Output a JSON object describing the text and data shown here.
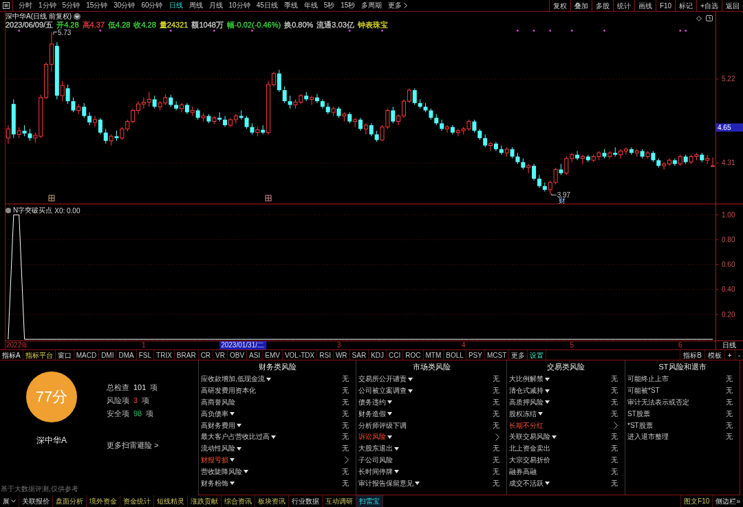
{
  "toolbar": {
    "periods": [
      {
        "label": "分时",
        "kind": "period",
        "selected": false
      },
      {
        "label": "1分钟",
        "kind": "period",
        "selected": false
      },
      {
        "label": "5分钟",
        "kind": "period",
        "selected": false
      },
      {
        "label": "15分钟",
        "kind": "period",
        "selected": false
      },
      {
        "label": "30分钟",
        "kind": "period",
        "selected": false
      },
      {
        "label": "60分钟",
        "kind": "period",
        "selected": false
      },
      {
        "label": "日线",
        "kind": "period",
        "selected": true
      },
      {
        "label": "周线",
        "kind": "period",
        "selected": false
      },
      {
        "label": "月线",
        "kind": "period",
        "selected": false
      },
      {
        "label": "10分钟",
        "kind": "period",
        "selected": false
      },
      {
        "label": "45日线",
        "kind": "period",
        "selected": false
      },
      {
        "label": "季线",
        "kind": "period",
        "selected": false
      },
      {
        "label": "年线",
        "kind": "period",
        "selected": false
      },
      {
        "label": "5秒",
        "kind": "period",
        "selected": false
      },
      {
        "label": "15秒",
        "kind": "period",
        "selected": false
      },
      {
        "label": "多周期",
        "kind": "period",
        "selected": false
      },
      {
        "label": "更多",
        "kind": "menu",
        "selected": false
      }
    ],
    "buttons": [
      "复权",
      "叠加",
      "多股",
      "统计",
      "画线",
      "F10",
      "标记",
      "+自选",
      "返回"
    ]
  },
  "price_pane": {
    "title": "深中华A(日线 前复权)",
    "quote": [
      {
        "text": "2023/06/09/五",
        "color": "#c8c8c8"
      },
      {
        "text": "开4.28",
        "color": "#3cd23c"
      },
      {
        "text": "高4.37",
        "color": "#e63c3c"
      },
      {
        "text": "低4.28",
        "color": "#3cd23c"
      },
      {
        "text": "收4.28",
        "color": "#3cd23c"
      },
      {
        "text": "量24321",
        "color": "#d8d830"
      },
      {
        "text": "额1048万",
        "color": "#c8c8c8"
      },
      {
        "text": "幅-0.02(-0.46%)",
        "color": "#3cd23c"
      },
      {
        "text": "换0.80%",
        "color": "#c8c8c8"
      },
      {
        "text": "流通3.03亿",
        "color": "#c8c8c8"
      },
      {
        "text": "钟表珠宝",
        "color": "#d8d830"
      }
    ],
    "cursor_price": "4.65",
    "chart_data": [
      {
        "type": "candlestick",
        "ylim": [
          3.87,
          5.95
        ],
        "yticks": [
          4.31,
          5.22
        ],
        "grid": true,
        "annotations": [
          "5.73",
          "3.97",
          "财"
        ],
        "ohlc": [
          [
            4.58,
            4.72,
            4.52,
            4.68
          ],
          [
            4.95,
            5.0,
            4.58,
            4.62
          ],
          [
            4.62,
            4.7,
            4.58,
            4.66
          ],
          [
            4.66,
            4.72,
            4.6,
            4.63
          ],
          [
            4.63,
            4.68,
            4.55,
            4.58
          ],
          [
            4.58,
            4.64,
            4.53,
            4.61
          ],
          [
            4.6,
            5.05,
            4.58,
            5.02
          ],
          [
            5.02,
            5.4,
            5.0,
            5.38
          ],
          [
            5.38,
            5.73,
            5.3,
            5.6
          ],
          [
            5.58,
            5.62,
            5.0,
            5.04
          ],
          [
            5.04,
            5.2,
            4.98,
            5.15
          ],
          [
            5.12,
            5.16,
            4.95,
            4.98
          ],
          [
            4.98,
            5.02,
            4.86,
            4.88
          ],
          [
            4.88,
            4.95,
            4.84,
            4.92
          ],
          [
            4.92,
            4.96,
            4.8,
            4.82
          ],
          [
            4.82,
            4.86,
            4.72,
            4.75
          ],
          [
            4.75,
            4.82,
            4.7,
            4.78
          ],
          [
            4.78,
            4.8,
            4.62,
            4.64
          ],
          [
            4.64,
            4.68,
            4.52,
            4.55
          ],
          [
            4.55,
            4.62,
            4.5,
            4.6
          ],
          [
            4.6,
            4.66,
            4.55,
            4.58
          ],
          [
            4.58,
            4.7,
            4.56,
            4.68
          ],
          [
            4.68,
            4.78,
            4.65,
            4.76
          ],
          [
            4.76,
            4.9,
            4.74,
            4.88
          ],
          [
            4.88,
            4.98,
            4.84,
            4.95
          ],
          [
            4.95,
            5.02,
            4.9,
            4.97
          ],
          [
            4.97,
            5.08,
            4.92,
            5.0
          ],
          [
            5.0,
            5.04,
            4.9,
            4.92
          ],
          [
            4.92,
            4.98,
            4.88,
            4.96
          ],
          [
            4.96,
            5.06,
            4.94,
            5.02
          ],
          [
            5.02,
            5.05,
            4.92,
            4.94
          ],
          [
            4.94,
            4.98,
            4.88,
            4.9
          ],
          [
            4.9,
            4.96,
            4.86,
            4.94
          ],
          [
            4.94,
            4.96,
            4.84,
            4.86
          ],
          [
            4.86,
            4.92,
            4.82,
            4.88
          ],
          [
            4.88,
            4.9,
            4.78,
            4.8
          ],
          [
            4.8,
            4.85,
            4.76,
            4.82
          ],
          [
            4.82,
            4.84,
            4.74,
            4.76
          ],
          [
            4.76,
            4.82,
            4.73,
            4.8
          ],
          [
            4.8,
            4.86,
            4.76,
            4.78
          ],
          [
            4.78,
            4.82,
            4.7,
            4.72
          ],
          [
            4.72,
            4.8,
            4.7,
            4.78
          ],
          [
            4.78,
            4.84,
            4.74,
            4.82
          ],
          [
            4.82,
            4.88,
            4.78,
            4.8
          ],
          [
            4.8,
            4.82,
            4.68,
            4.7
          ],
          [
            4.7,
            4.74,
            4.62,
            4.64
          ],
          [
            4.64,
            4.7,
            4.6,
            4.67
          ],
          [
            4.67,
            4.72,
            4.62,
            4.64
          ],
          [
            4.64,
            5.2,
            4.62,
            5.16
          ],
          [
            5.16,
            5.3,
            5.14,
            5.28
          ],
          [
            5.28,
            5.32,
            5.08,
            5.1
          ],
          [
            5.1,
            5.14,
            4.96,
            4.98
          ],
          [
            4.98,
            5.04,
            4.9,
            4.94
          ],
          [
            4.94,
            5.0,
            4.9,
            4.97
          ],
          [
            4.97,
            5.06,
            4.95,
            5.04
          ],
          [
            5.04,
            5.08,
            4.98,
            5.0
          ],
          [
            5.0,
            5.04,
            4.94,
            5.02
          ],
          [
            5.02,
            5.06,
            4.96,
            4.98
          ],
          [
            4.98,
            5.0,
            4.9,
            4.92
          ],
          [
            4.92,
            4.96,
            4.84,
            4.86
          ],
          [
            4.86,
            4.92,
            4.82,
            4.9
          ],
          [
            4.9,
            4.92,
            4.8,
            4.82
          ],
          [
            4.82,
            4.86,
            4.76,
            4.84
          ],
          [
            4.84,
            4.86,
            4.74,
            4.76
          ],
          [
            4.76,
            4.8,
            4.7,
            4.78
          ],
          [
            4.78,
            4.8,
            4.66,
            4.68
          ],
          [
            4.68,
            4.74,
            4.62,
            4.72
          ],
          [
            4.72,
            4.74,
            4.6,
            4.62
          ],
          [
            4.62,
            4.66,
            4.54,
            4.56
          ],
          [
            4.56,
            4.72,
            4.55,
            4.7
          ],
          [
            4.7,
            4.9,
            4.68,
            4.88
          ],
          [
            4.88,
            4.92,
            4.74,
            4.76
          ],
          [
            4.76,
            4.84,
            4.72,
            4.82
          ],
          [
            4.82,
            5.0,
            4.8,
            4.98
          ],
          [
            4.98,
            5.12,
            4.96,
            5.1
          ],
          [
            5.1,
            5.12,
            4.94,
            4.96
          ],
          [
            4.96,
            5.0,
            4.9,
            4.92
          ],
          [
            4.92,
            4.96,
            4.86,
            4.88
          ],
          [
            4.88,
            4.9,
            4.78,
            4.8
          ],
          [
            4.8,
            4.84,
            4.72,
            4.74
          ],
          [
            4.74,
            4.78,
            4.66,
            4.68
          ],
          [
            4.68,
            4.72,
            4.64,
            4.7
          ],
          [
            4.7,
            4.72,
            4.62,
            4.64
          ],
          [
            4.64,
            4.68,
            4.6,
            4.66
          ],
          [
            4.66,
            4.7,
            4.62,
            4.68
          ],
          [
            4.68,
            4.78,
            4.66,
            4.76
          ],
          [
            4.76,
            4.78,
            4.64,
            4.66
          ],
          [
            4.66,
            4.68,
            4.56,
            4.58
          ],
          [
            4.58,
            4.62,
            4.48,
            4.5
          ],
          [
            4.5,
            4.54,
            4.44,
            4.52
          ],
          [
            4.52,
            4.54,
            4.44,
            4.46
          ],
          [
            4.46,
            4.5,
            4.4,
            4.42
          ],
          [
            4.42,
            4.48,
            4.38,
            4.46
          ],
          [
            4.46,
            4.48,
            4.36,
            4.38
          ],
          [
            4.38,
            4.42,
            4.3,
            4.32
          ],
          [
            4.32,
            4.36,
            4.24,
            4.26
          ],
          [
            4.26,
            4.3,
            4.2,
            4.28
          ],
          [
            4.28,
            4.3,
            4.12,
            4.14
          ],
          [
            4.14,
            4.18,
            4.04,
            4.06
          ],
          [
            4.06,
            4.1,
            4.0,
            4.02
          ],
          [
            4.02,
            4.12,
            3.97,
            4.1
          ],
          [
            4.1,
            4.26,
            4.08,
            4.24
          ],
          [
            4.24,
            4.3,
            4.18,
            4.2
          ],
          [
            4.2,
            4.38,
            4.18,
            4.36
          ],
          [
            4.36,
            4.42,
            4.32,
            4.4
          ],
          [
            4.4,
            4.44,
            4.34,
            4.36
          ],
          [
            4.36,
            4.4,
            4.3,
            4.38
          ],
          [
            4.38,
            4.4,
            4.32,
            4.34
          ],
          [
            4.34,
            4.4,
            4.32,
            4.38
          ],
          [
            4.38,
            4.44,
            4.34,
            4.42
          ],
          [
            4.42,
            4.46,
            4.36,
            4.38
          ],
          [
            4.38,
            4.44,
            4.36,
            4.42
          ],
          [
            4.42,
            4.48,
            4.38,
            4.4
          ],
          [
            4.4,
            4.46,
            4.36,
            4.44
          ],
          [
            4.44,
            4.48,
            4.4,
            4.46
          ],
          [
            4.46,
            4.48,
            4.4,
            4.42
          ],
          [
            4.42,
            4.46,
            4.38,
            4.44
          ],
          [
            4.44,
            4.46,
            4.36,
            4.38
          ],
          [
            4.38,
            4.44,
            4.36,
            4.42
          ],
          [
            4.42,
            4.44,
            4.32,
            4.34
          ],
          [
            4.34,
            4.36,
            4.26,
            4.28
          ],
          [
            4.28,
            4.32,
            4.24,
            4.3
          ],
          [
            4.3,
            4.36,
            4.28,
            4.34
          ],
          [
            4.34,
            4.36,
            4.28,
            4.3
          ],
          [
            4.3,
            4.4,
            4.28,
            4.38
          ],
          [
            4.38,
            4.4,
            4.3,
            4.32
          ],
          [
            4.32,
            4.4,
            4.3,
            4.38
          ],
          [
            4.38,
            4.42,
            4.34,
            4.4
          ],
          [
            4.4,
            4.42,
            4.32,
            4.34
          ],
          [
            4.34,
            4.4,
            4.3,
            4.36
          ],
          [
            4.28,
            4.37,
            4.28,
            4.28
          ]
        ]
      }
    ]
  },
  "indicator_pane": {
    "title": "N字突破买点",
    "reading": "X0: 0.00",
    "chart_data": [
      {
        "type": "line",
        "color": "#ffffff",
        "ylim": [
          -0.01,
          1.09
        ],
        "yticks": [
          {
            "value": 0.2,
            "label": "0.20"
          },
          {
            "value": 0.4,
            "label": "0.40"
          },
          {
            "value": 0.6,
            "label": "0.60"
          },
          {
            "value": 0.8,
            "label": "0.80"
          },
          {
            "value": 1.0,
            "label": "1.00"
          }
        ],
        "grid": true,
        "categories": [
          null,
          null,
          null,
          null,
          null,
          null,
          null,
          null,
          null,
          null,
          null,
          null,
          null,
          null,
          null,
          null,
          null,
          null,
          null,
          null,
          null,
          null,
          null,
          null,
          null,
          "1",
          null,
          null,
          null,
          null,
          null,
          null,
          null,
          null,
          null,
          null,
          null,
          null,
          null,
          null,
          null,
          null,
          null,
          null,
          null,
          null,
          null,
          null,
          null,
          null,
          null,
          null,
          null,
          null,
          null,
          null,
          null,
          null,
          null,
          null,
          null,
          "3",
          null,
          null,
          null,
          null,
          null,
          null,
          null,
          null,
          null,
          null,
          null,
          null,
          null,
          null,
          null,
          null,
          null,
          null,
          null,
          null,
          null,
          null,
          "4",
          null,
          null,
          null,
          null,
          null,
          null,
          null,
          null,
          null,
          null,
          null,
          null,
          null,
          null,
          null,
          null,
          null,
          null,
          null,
          "5",
          null,
          null,
          null,
          null,
          null,
          null,
          null,
          null,
          null,
          null,
          null,
          null,
          null,
          null,
          null,
          null,
          null,
          null,
          null,
          "6",
          null,
          null,
          null,
          null,
          null,
          null
        ],
        "values": [
          0,
          1,
          1,
          0,
          0,
          0,
          0,
          0,
          0,
          0,
          0,
          0,
          0,
          0,
          0,
          0,
          0,
          0,
          0,
          0,
          0,
          0,
          0,
          0,
          0,
          0,
          0,
          0,
          0,
          0,
          0,
          0,
          0,
          0,
          0,
          0,
          0,
          0,
          0,
          0,
          0,
          0,
          0,
          0,
          0,
          0,
          0,
          0,
          0,
          0,
          0,
          0,
          0,
          0,
          0,
          0,
          0,
          0,
          0,
          0,
          0,
          0,
          0,
          0,
          0,
          0,
          0,
          0,
          0,
          0,
          0,
          0,
          0,
          0,
          0,
          0,
          0,
          0,
          0,
          0,
          0,
          0,
          0,
          0,
          0,
          0,
          0,
          0,
          0,
          0,
          0,
          0,
          0,
          0,
          0,
          0,
          0,
          0,
          0,
          0,
          0,
          0,
          0,
          0,
          0,
          0,
          0,
          0,
          0,
          0,
          0,
          0,
          0,
          0,
          0,
          0,
          0,
          0,
          0,
          0,
          0,
          0,
          0,
          0,
          0,
          0,
          0,
          0,
          0,
          0,
          0
        ]
      }
    ]
  },
  "time_axis": {
    "year_label": "2022年",
    "cursor_date": "2023/01/31/二",
    "period": "日线"
  },
  "indicator_bar": {
    "left": [
      {
        "label": "指标A",
        "kind": "switch"
      },
      {
        "label": "指标平台",
        "kind": "platform"
      },
      {
        "label": "窗口",
        "kind": "plain"
      },
      {
        "label": "MACD",
        "kind": "plain"
      },
      {
        "label": "DMI",
        "kind": "plain"
      },
      {
        "label": "DMA",
        "kind": "plain"
      },
      {
        "label": "FSL",
        "kind": "plain"
      },
      {
        "label": "TRIX",
        "kind": "plain"
      },
      {
        "label": "BRAR",
        "kind": "plain"
      },
      {
        "label": "CR",
        "kind": "plain"
      },
      {
        "label": "VR",
        "kind": "plain"
      },
      {
        "label": "OBV",
        "kind": "plain"
      },
      {
        "label": "ASI",
        "kind": "plain"
      },
      {
        "label": "EMV",
        "kind": "plain"
      },
      {
        "label": "VOL-TDX",
        "kind": "plain"
      },
      {
        "label": "RSI",
        "kind": "plain"
      },
      {
        "label": "WR",
        "kind": "plain"
      },
      {
        "label": "SAR",
        "kind": "plain"
      },
      {
        "label": "KDJ",
        "kind": "plain"
      },
      {
        "label": "CCI",
        "kind": "plain"
      },
      {
        "label": "ROC",
        "kind": "plain"
      },
      {
        "label": "MTM",
        "kind": "plain"
      },
      {
        "label": "BOLL",
        "kind": "plain"
      },
      {
        "label": "PSY",
        "kind": "plain"
      },
      {
        "label": "MCST",
        "kind": "plain"
      },
      {
        "label": "更多",
        "kind": "plain"
      },
      {
        "label": "设置",
        "kind": "setup"
      }
    ],
    "right": [
      "指标B",
      "模板",
      "+",
      "-"
    ]
  },
  "risk_scan": {
    "score": "77分",
    "stock": "深中华A",
    "stats": [
      {
        "label": "总检查",
        "value": "101",
        "unit": "项",
        "kind": "total"
      },
      {
        "label": "风险项",
        "value": "3",
        "unit": "项",
        "kind": "risk"
      },
      {
        "label": "安全项",
        "value": "98",
        "unit": "项",
        "kind": "safe"
      }
    ],
    "more_link": "更多扫雷避险 >",
    "footnote": "基于大数据评测,仅供参考",
    "columns": [
      {
        "title": "财务类风险",
        "items": [
          {
            "name": "应收款增加,低现金流",
            "expandable": true,
            "flagged": false,
            "status": "无"
          },
          {
            "name": "高研发费用资本化",
            "expandable": false,
            "flagged": false,
            "status": "无"
          },
          {
            "name": "高商誉风险",
            "expandable": false,
            "flagged": false,
            "status": "无"
          },
          {
            "name": "高负债率",
            "expandable": true,
            "flagged": false,
            "status": "无"
          },
          {
            "name": "高财务费用",
            "expandable": true,
            "flagged": false,
            "status": "无"
          },
          {
            "name": "最大客户占营收比过高",
            "expandable": true,
            "flagged": false,
            "status": "无"
          },
          {
            "name": "流动性风险",
            "expandable": true,
            "flagged": false,
            "status": "无"
          },
          {
            "name": "财报亏损",
            "expandable": true,
            "flagged": true
          },
          {
            "name": "营收陡降风险",
            "expandable": true,
            "flagged": false,
            "status": "无"
          },
          {
            "name": "财务粉饰",
            "expandable": true,
            "flagged": false,
            "status": "无"
          }
        ]
      },
      {
        "title": "市场类风险",
        "items": [
          {
            "name": "交易所公开谴责",
            "expandable": true,
            "flagged": false,
            "status": "无"
          },
          {
            "name": "公司被立案调查",
            "expandable": true,
            "flagged": false,
            "status": "无"
          },
          {
            "name": "债务违约",
            "expandable": true,
            "flagged": false,
            "status": "无"
          },
          {
            "name": "财务造假",
            "expandable": true,
            "flagged": false,
            "status": "无"
          },
          {
            "name": "分析师评级下调",
            "expandable": false,
            "flagged": false,
            "status": "无"
          },
          {
            "name": "诉讼风险",
            "expandable": true,
            "flagged": true
          },
          {
            "name": "大股东退出",
            "expandable": true,
            "flagged": false,
            "status": "无"
          },
          {
            "name": "子公司风险",
            "expandable": false,
            "flagged": false,
            "status": "无"
          },
          {
            "name": "长时间停牌",
            "expandable": true,
            "flagged": false,
            "status": "无"
          },
          {
            "name": "审计报告保留意见",
            "expandable": true,
            "flagged": false,
            "status": "无"
          }
        ]
      },
      {
        "title": "交易类风险",
        "items": [
          {
            "name": "大比例解禁",
            "expandable": true,
            "flagged": false,
            "status": "无"
          },
          {
            "name": "清仓式减持",
            "expandable": true,
            "flagged": false,
            "status": "无"
          },
          {
            "name": "高质押风险",
            "expandable": true,
            "flagged": false,
            "status": "无"
          },
          {
            "name": "股权冻结",
            "expandable": true,
            "flagged": false,
            "status": "无"
          },
          {
            "name": "长期不分红",
            "expandable": false,
            "flagged": true
          },
          {
            "name": "关联交易风险",
            "expandable": true,
            "flagged": false,
            "status": "无"
          },
          {
            "name": "北上资金卖出",
            "expandable": false,
            "flagged": false,
            "status": "无"
          },
          {
            "name": "大宗交易折价",
            "expandable": false,
            "flagged": false,
            "status": "无"
          },
          {
            "name": "融券高融",
            "expandable": false,
            "flagged": false,
            "status": "无"
          },
          {
            "name": "成交不活跃",
            "expandable": true,
            "flagged": false,
            "status": "无"
          }
        ]
      },
      {
        "title": "ST风险和退市",
        "items": [
          {
            "name": "可能终止上市",
            "expandable": false,
            "flagged": false,
            "status": "无"
          },
          {
            "name": "可能被*ST",
            "expandable": false,
            "flagged": false,
            "status": "无"
          },
          {
            "name": "审计无法表示或否定",
            "expandable": false,
            "flagged": false,
            "status": "无"
          },
          {
            "name": "ST股票",
            "expandable": false,
            "flagged": false,
            "status": "无"
          },
          {
            "name": "*ST股票",
            "expandable": false,
            "flagged": false,
            "status": "无"
          },
          {
            "name": "进入退市整理",
            "expandable": false,
            "flagged": false,
            "status": "无"
          }
        ]
      }
    ]
  },
  "bottom_bar": {
    "tabs": [
      {
        "label": "展",
        "kind": "menu",
        "selected": false
      },
      {
        "label": "关联报价",
        "kind": "plain",
        "selected": false
      },
      {
        "label": "盘面分析",
        "kind": "info",
        "selected": false
      },
      {
        "label": "境外资金",
        "kind": "info",
        "selected": false
      },
      {
        "label": "资金统计",
        "kind": "info",
        "selected": false
      },
      {
        "label": "短线精灵",
        "kind": "info",
        "selected": false
      },
      {
        "label": "涨跌贡献",
        "kind": "info",
        "selected": false
      },
      {
        "label": "综合资讯",
        "kind": "info",
        "selected": false
      },
      {
        "label": "板块资讯",
        "kind": "info",
        "selected": false
      },
      {
        "label": "行业数据",
        "kind": "plain",
        "selected": false
      },
      {
        "label": "互动调研",
        "kind": "info",
        "selected": false
      },
      {
        "label": "扫雷宝",
        "kind": "info",
        "selected": true
      }
    ],
    "right": [
      {
        "label": "图文F10",
        "kind": "info"
      },
      {
        "label": "侧边栏»",
        "kind": "plain"
      }
    ]
  }
}
